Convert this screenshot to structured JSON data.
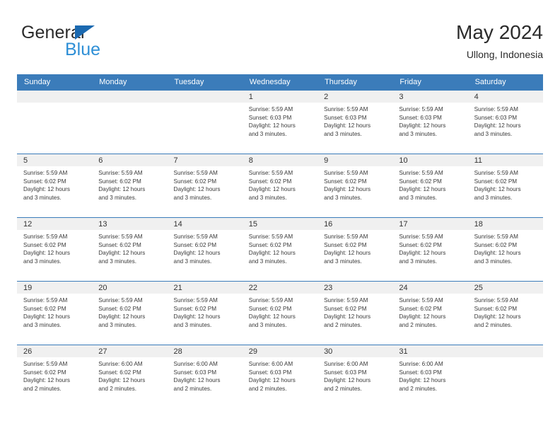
{
  "brand": {
    "name_part1": "General",
    "name_part2": "Blue",
    "triangle_color": "#1b69b0",
    "blue_color": "#2e8fd6"
  },
  "header": {
    "title": "May 2024",
    "location": "Ullong, Indonesia"
  },
  "theme": {
    "header_blue": "#3b7cba",
    "date_band_gray": "#f0f0f0",
    "text_color": "#333333"
  },
  "weekdays": [
    "Sunday",
    "Monday",
    "Tuesday",
    "Wednesday",
    "Thursday",
    "Friday",
    "Saturday"
  ],
  "weeks": [
    [
      {
        "day": "",
        "sunrise": "",
        "sunset": "",
        "daylight_line1": "",
        "daylight_line2": "",
        "empty": true
      },
      {
        "day": "",
        "sunrise": "",
        "sunset": "",
        "daylight_line1": "",
        "daylight_line2": "",
        "empty": true
      },
      {
        "day": "",
        "sunrise": "",
        "sunset": "",
        "daylight_line1": "",
        "daylight_line2": "",
        "empty": true
      },
      {
        "day": "1",
        "sunrise": "Sunrise: 5:59 AM",
        "sunset": "Sunset: 6:03 PM",
        "daylight_line1": "Daylight: 12 hours",
        "daylight_line2": "and 3 minutes.",
        "empty": false
      },
      {
        "day": "2",
        "sunrise": "Sunrise: 5:59 AM",
        "sunset": "Sunset: 6:03 PM",
        "daylight_line1": "Daylight: 12 hours",
        "daylight_line2": "and 3 minutes.",
        "empty": false
      },
      {
        "day": "3",
        "sunrise": "Sunrise: 5:59 AM",
        "sunset": "Sunset: 6:03 PM",
        "daylight_line1": "Daylight: 12 hours",
        "daylight_line2": "and 3 minutes.",
        "empty": false
      },
      {
        "day": "4",
        "sunrise": "Sunrise: 5:59 AM",
        "sunset": "Sunset: 6:03 PM",
        "daylight_line1": "Daylight: 12 hours",
        "daylight_line2": "and 3 minutes.",
        "empty": false
      }
    ],
    [
      {
        "day": "5",
        "sunrise": "Sunrise: 5:59 AM",
        "sunset": "Sunset: 6:02 PM",
        "daylight_line1": "Daylight: 12 hours",
        "daylight_line2": "and 3 minutes.",
        "empty": false
      },
      {
        "day": "6",
        "sunrise": "Sunrise: 5:59 AM",
        "sunset": "Sunset: 6:02 PM",
        "daylight_line1": "Daylight: 12 hours",
        "daylight_line2": "and 3 minutes.",
        "empty": false
      },
      {
        "day": "7",
        "sunrise": "Sunrise: 5:59 AM",
        "sunset": "Sunset: 6:02 PM",
        "daylight_line1": "Daylight: 12 hours",
        "daylight_line2": "and 3 minutes.",
        "empty": false
      },
      {
        "day": "8",
        "sunrise": "Sunrise: 5:59 AM",
        "sunset": "Sunset: 6:02 PM",
        "daylight_line1": "Daylight: 12 hours",
        "daylight_line2": "and 3 minutes.",
        "empty": false
      },
      {
        "day": "9",
        "sunrise": "Sunrise: 5:59 AM",
        "sunset": "Sunset: 6:02 PM",
        "daylight_line1": "Daylight: 12 hours",
        "daylight_line2": "and 3 minutes.",
        "empty": false
      },
      {
        "day": "10",
        "sunrise": "Sunrise: 5:59 AM",
        "sunset": "Sunset: 6:02 PM",
        "daylight_line1": "Daylight: 12 hours",
        "daylight_line2": "and 3 minutes.",
        "empty": false
      },
      {
        "day": "11",
        "sunrise": "Sunrise: 5:59 AM",
        "sunset": "Sunset: 6:02 PM",
        "daylight_line1": "Daylight: 12 hours",
        "daylight_line2": "and 3 minutes.",
        "empty": false
      }
    ],
    [
      {
        "day": "12",
        "sunrise": "Sunrise: 5:59 AM",
        "sunset": "Sunset: 6:02 PM",
        "daylight_line1": "Daylight: 12 hours",
        "daylight_line2": "and 3 minutes.",
        "empty": false
      },
      {
        "day": "13",
        "sunrise": "Sunrise: 5:59 AM",
        "sunset": "Sunset: 6:02 PM",
        "daylight_line1": "Daylight: 12 hours",
        "daylight_line2": "and 3 minutes.",
        "empty": false
      },
      {
        "day": "14",
        "sunrise": "Sunrise: 5:59 AM",
        "sunset": "Sunset: 6:02 PM",
        "daylight_line1": "Daylight: 12 hours",
        "daylight_line2": "and 3 minutes.",
        "empty": false
      },
      {
        "day": "15",
        "sunrise": "Sunrise: 5:59 AM",
        "sunset": "Sunset: 6:02 PM",
        "daylight_line1": "Daylight: 12 hours",
        "daylight_line2": "and 3 minutes.",
        "empty": false
      },
      {
        "day": "16",
        "sunrise": "Sunrise: 5:59 AM",
        "sunset": "Sunset: 6:02 PM",
        "daylight_line1": "Daylight: 12 hours",
        "daylight_line2": "and 3 minutes.",
        "empty": false
      },
      {
        "day": "17",
        "sunrise": "Sunrise: 5:59 AM",
        "sunset": "Sunset: 6:02 PM",
        "daylight_line1": "Daylight: 12 hours",
        "daylight_line2": "and 3 minutes.",
        "empty": false
      },
      {
        "day": "18",
        "sunrise": "Sunrise: 5:59 AM",
        "sunset": "Sunset: 6:02 PM",
        "daylight_line1": "Daylight: 12 hours",
        "daylight_line2": "and 3 minutes.",
        "empty": false
      }
    ],
    [
      {
        "day": "19",
        "sunrise": "Sunrise: 5:59 AM",
        "sunset": "Sunset: 6:02 PM",
        "daylight_line1": "Daylight: 12 hours",
        "daylight_line2": "and 3 minutes.",
        "empty": false
      },
      {
        "day": "20",
        "sunrise": "Sunrise: 5:59 AM",
        "sunset": "Sunset: 6:02 PM",
        "daylight_line1": "Daylight: 12 hours",
        "daylight_line2": "and 3 minutes.",
        "empty": false
      },
      {
        "day": "21",
        "sunrise": "Sunrise: 5:59 AM",
        "sunset": "Sunset: 6:02 PM",
        "daylight_line1": "Daylight: 12 hours",
        "daylight_line2": "and 3 minutes.",
        "empty": false
      },
      {
        "day": "22",
        "sunrise": "Sunrise: 5:59 AM",
        "sunset": "Sunset: 6:02 PM",
        "daylight_line1": "Daylight: 12 hours",
        "daylight_line2": "and 3 minutes.",
        "empty": false
      },
      {
        "day": "23",
        "sunrise": "Sunrise: 5:59 AM",
        "sunset": "Sunset: 6:02 PM",
        "daylight_line1": "Daylight: 12 hours",
        "daylight_line2": "and 2 minutes.",
        "empty": false
      },
      {
        "day": "24",
        "sunrise": "Sunrise: 5:59 AM",
        "sunset": "Sunset: 6:02 PM",
        "daylight_line1": "Daylight: 12 hours",
        "daylight_line2": "and 2 minutes.",
        "empty": false
      },
      {
        "day": "25",
        "sunrise": "Sunrise: 5:59 AM",
        "sunset": "Sunset: 6:02 PM",
        "daylight_line1": "Daylight: 12 hours",
        "daylight_line2": "and 2 minutes.",
        "empty": false
      }
    ],
    [
      {
        "day": "26",
        "sunrise": "Sunrise: 5:59 AM",
        "sunset": "Sunset: 6:02 PM",
        "daylight_line1": "Daylight: 12 hours",
        "daylight_line2": "and 2 minutes.",
        "empty": false
      },
      {
        "day": "27",
        "sunrise": "Sunrise: 6:00 AM",
        "sunset": "Sunset: 6:02 PM",
        "daylight_line1": "Daylight: 12 hours",
        "daylight_line2": "and 2 minutes.",
        "empty": false
      },
      {
        "day": "28",
        "sunrise": "Sunrise: 6:00 AM",
        "sunset": "Sunset: 6:03 PM",
        "daylight_line1": "Daylight: 12 hours",
        "daylight_line2": "and 2 minutes.",
        "empty": false
      },
      {
        "day": "29",
        "sunrise": "Sunrise: 6:00 AM",
        "sunset": "Sunset: 6:03 PM",
        "daylight_line1": "Daylight: 12 hours",
        "daylight_line2": "and 2 minutes.",
        "empty": false
      },
      {
        "day": "30",
        "sunrise": "Sunrise: 6:00 AM",
        "sunset": "Sunset: 6:03 PM",
        "daylight_line1": "Daylight: 12 hours",
        "daylight_line2": "and 2 minutes.",
        "empty": false
      },
      {
        "day": "31",
        "sunrise": "Sunrise: 6:00 AM",
        "sunset": "Sunset: 6:03 PM",
        "daylight_line1": "Daylight: 12 hours",
        "daylight_line2": "and 2 minutes.",
        "empty": false
      },
      {
        "day": "",
        "sunrise": "",
        "sunset": "",
        "daylight_line1": "",
        "daylight_line2": "",
        "empty": true
      }
    ]
  ]
}
